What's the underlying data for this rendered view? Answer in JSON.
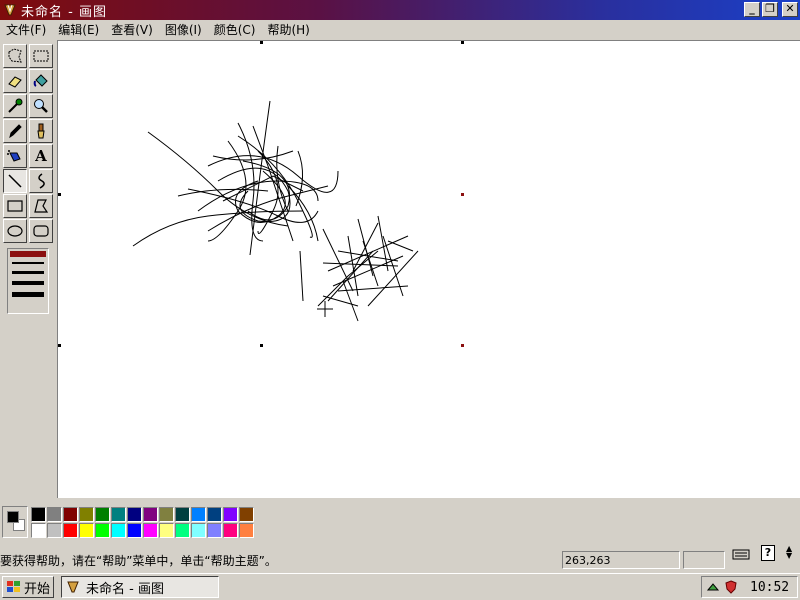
{
  "window": {
    "title": "未命名 - 画图",
    "minimize": "_",
    "restore": "❐",
    "close": "✕"
  },
  "menu": [
    "文件(F)",
    "编辑(E)",
    "查看(V)",
    "图像(I)",
    "颜色(C)",
    "帮助(H)"
  ],
  "tools": [
    {
      "name": "free-form-select",
      "icon": "free-select-icon"
    },
    {
      "name": "rect-select",
      "icon": "rect-select-icon"
    },
    {
      "name": "eraser",
      "icon": "eraser-icon"
    },
    {
      "name": "fill",
      "icon": "fill-bucket-icon"
    },
    {
      "name": "pick-color",
      "icon": "eyedropper-icon"
    },
    {
      "name": "magnifier",
      "icon": "magnifier-icon"
    },
    {
      "name": "pencil",
      "icon": "pencil-icon"
    },
    {
      "name": "brush",
      "icon": "brush-icon"
    },
    {
      "name": "airbrush",
      "icon": "airbrush-icon"
    },
    {
      "name": "text",
      "icon": "text-icon",
      "glyph": "A"
    },
    {
      "name": "line",
      "icon": "line-icon",
      "active": true
    },
    {
      "name": "curve",
      "icon": "curve-icon"
    },
    {
      "name": "rectangle",
      "icon": "rectangle-icon"
    },
    {
      "name": "polygon",
      "icon": "polygon-icon"
    },
    {
      "name": "ellipse",
      "icon": "ellipse-icon"
    },
    {
      "name": "rounded-rect",
      "icon": "rounded-rect-icon"
    }
  ],
  "line_widths": [
    1,
    2,
    3,
    4,
    5
  ],
  "selected_line_width": 1,
  "colors": {
    "foreground": "#000000",
    "background": "#ffffff",
    "palette_top": [
      "#000000",
      "#808080",
      "#800000",
      "#808000",
      "#008000",
      "#008080",
      "#000080",
      "#800080",
      "#808040",
      "#004040",
      "#0080ff",
      "#004080",
      "#8000ff",
      "#804000"
    ],
    "palette_bottom": [
      "#ffffff",
      "#c0c0c0",
      "#ff0000",
      "#ffff00",
      "#00ff00",
      "#00ffff",
      "#0000ff",
      "#ff00ff",
      "#ffff80",
      "#00ff80",
      "#80ffff",
      "#8080ff",
      "#ff0080",
      "#ff8040"
    ]
  },
  "status": {
    "help_text": "要获得帮助，请在“帮助”菜单中，单击“帮助主题”。",
    "coords": "263,263",
    "help_icon": "?"
  },
  "taskbar": {
    "start_label": "开始",
    "task_label": "未命名 - 画图",
    "clock": "10:52"
  }
}
